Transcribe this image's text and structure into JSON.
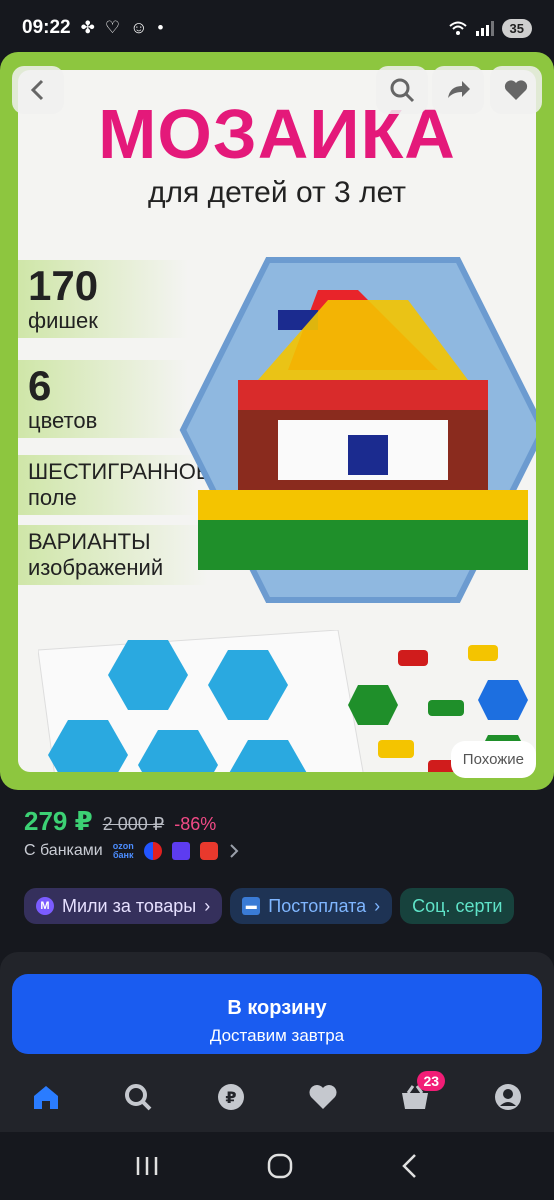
{
  "status_bar": {
    "time": "09:22",
    "battery": "35"
  },
  "product_image": {
    "title": "МОЗАИКА",
    "subtitle": "для детей от 3 лет",
    "features": [
      {
        "big": "170",
        "small": "фишек"
      },
      {
        "big": "6",
        "small": "цветов"
      },
      {
        "big": "",
        "small": "ШЕСТИГРАННОЕ поле"
      },
      {
        "big": "",
        "small": "ВАРИАНТЫ изображений"
      }
    ],
    "similar_label": "Похожие"
  },
  "price": {
    "current": "279 ₽",
    "old": "2 000 ₽",
    "discount": "-86%",
    "banks_label": "С банками",
    "ozon_bank_line1": "ozon",
    "ozon_bank_line2": "банк"
  },
  "tags": [
    {
      "label": "Мили за товары",
      "icon": "m-icon"
    },
    {
      "label": "Постоплата",
      "icon": "card-icon"
    },
    {
      "label": "Соц. серти",
      "icon": ""
    }
  ],
  "cart": {
    "title": "В корзину",
    "subtitle": "Доставим завтра"
  },
  "bottom_nav": {
    "cart_badge": "23",
    "accent": "#1a5cf0"
  },
  "colors": {
    "price": "#3cd174",
    "discount": "#f24a86",
    "frame": "#8dc63f",
    "title": "#e4197a"
  }
}
